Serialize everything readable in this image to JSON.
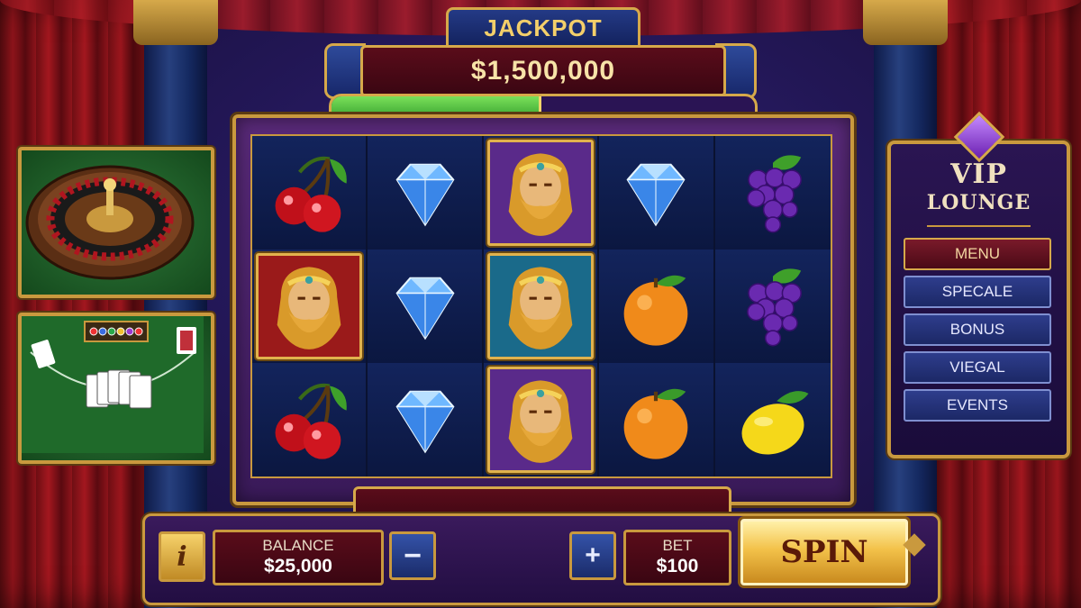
{
  "jackpot": {
    "title": "JACKPOT",
    "amount": "$1,500,000",
    "progress": 0.49
  },
  "reels": [
    [
      "cherry",
      "zeus-red",
      "cherry"
    ],
    [
      "diamond",
      "diamond",
      "diamond"
    ],
    [
      "zeus-purple",
      "zeus-teal",
      "zeus-purple"
    ],
    [
      "diamond",
      "orange",
      "orange"
    ],
    [
      "grapes",
      "grapes",
      "lemon"
    ]
  ],
  "vip": {
    "title": "VIP",
    "subtitle": "LOUNGE",
    "menu": [
      "MENU",
      "SPECALE",
      "BONUS",
      "VIEGAL",
      "EVENTS"
    ],
    "active": 0
  },
  "controls": {
    "info_label": "i",
    "balance_label": "BALANCE",
    "balance_value": "$25,000",
    "minus_label": "−",
    "plus_label": "+",
    "bet_label": "BET",
    "bet_value": "$100",
    "spin_label": "SPIN"
  },
  "colors": {
    "gold": "#d6a94a",
    "jackpot_fill": "#4fbf3a",
    "panel_red": "#5a0c1a",
    "button_blue": "#2e3d8c"
  }
}
